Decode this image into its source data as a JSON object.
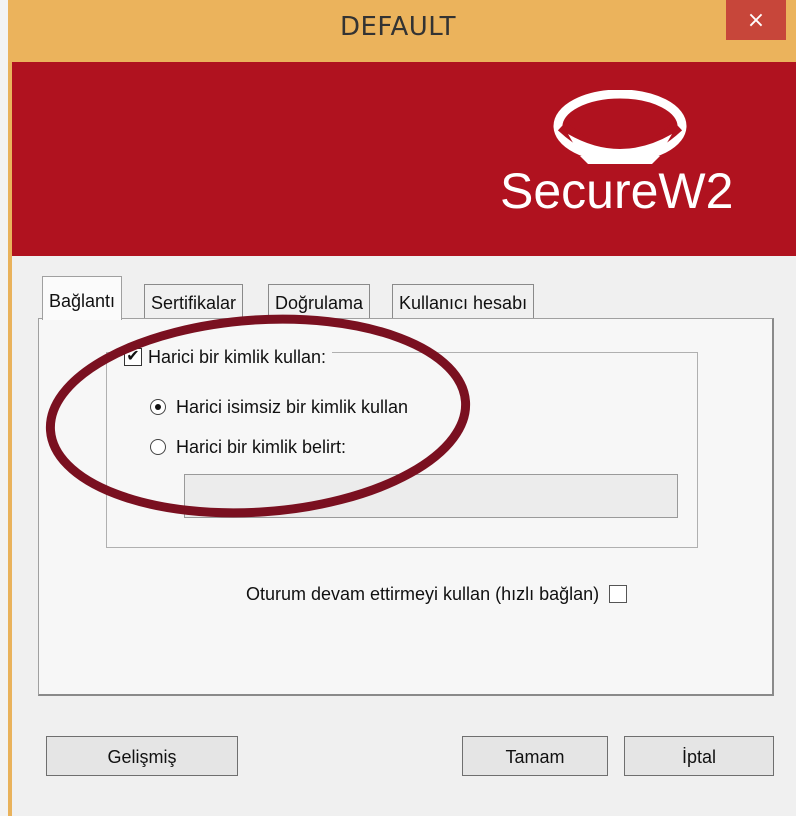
{
  "window": {
    "title": "DEFAULT",
    "close_label": "×"
  },
  "banner": {
    "logo_text": "SecureW2",
    "color": "#b0121f"
  },
  "tabs": [
    {
      "label": "Bağlantı",
      "active": true
    },
    {
      "label": "Sertifikalar",
      "active": false
    },
    {
      "label": "Doğrulama",
      "active": false
    },
    {
      "label": "Kullanıcı hesabı",
      "active": false
    }
  ],
  "identity": {
    "use_external_label": "Harici bir kimlik kullan:",
    "use_external_checked": true,
    "anonymous_label": "Harici isimsiz bir kimlik kullan",
    "anonymous_selected": true,
    "specify_label": "Harici bir kimlik belirt:",
    "specify_selected": false,
    "identity_value": ""
  },
  "session": {
    "label": "Oturum devam ettirmeyi kullan (hızlı bağlan)",
    "checked": false
  },
  "buttons": {
    "advanced": "Gelişmiş",
    "ok": "Tamam",
    "cancel": "İptal"
  },
  "annotation": {
    "ellipse_color": "#7a1020"
  }
}
